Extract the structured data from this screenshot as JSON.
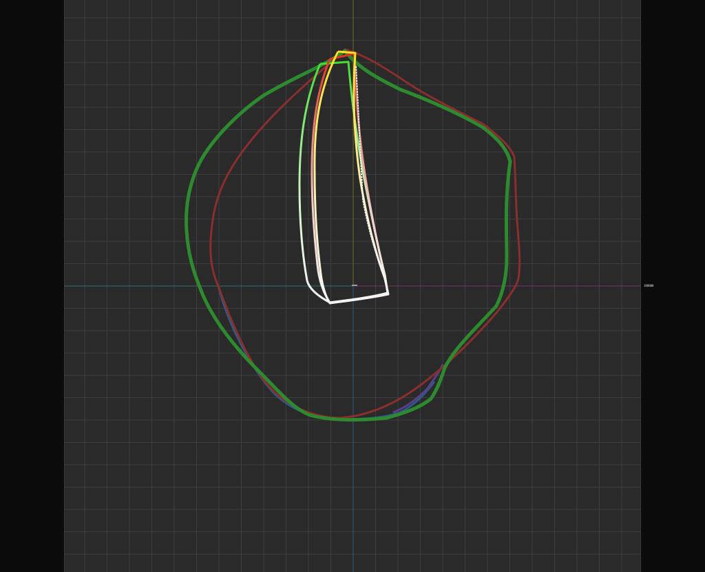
{
  "viewport": {
    "name": "curve-editor-viewport",
    "background_color": "#2a2a2b",
    "grid_color": "#3e3e40",
    "grid_major_color": "#4a4a4c"
  },
  "axes": {
    "x_negative_color": "#2f6e7a",
    "x_positive_color": "#7a2f6a",
    "y_positive_color": "#6f6f2a",
    "y_negative_color": "#2f5a7a",
    "readout_text": "100000"
  },
  "curves": [
    {
      "name": "outer-green-curve",
      "color": "#2e8a2e"
    },
    {
      "name": "outer-red-curve",
      "color": "#8a2e2e"
    },
    {
      "name": "outer-blue-curve",
      "color": "#2e5a8a"
    },
    {
      "name": "outer-purple-curve",
      "color": "#5a3e8a"
    },
    {
      "name": "inner-green-curve",
      "color": "#44dd33"
    },
    {
      "name": "inner-red-curve",
      "color": "#dd3322"
    },
    {
      "name": "inner-yellow-curve",
      "color": "#ffdd22"
    },
    {
      "name": "inner-white-curve",
      "color": "#f2f2f2"
    }
  ]
}
